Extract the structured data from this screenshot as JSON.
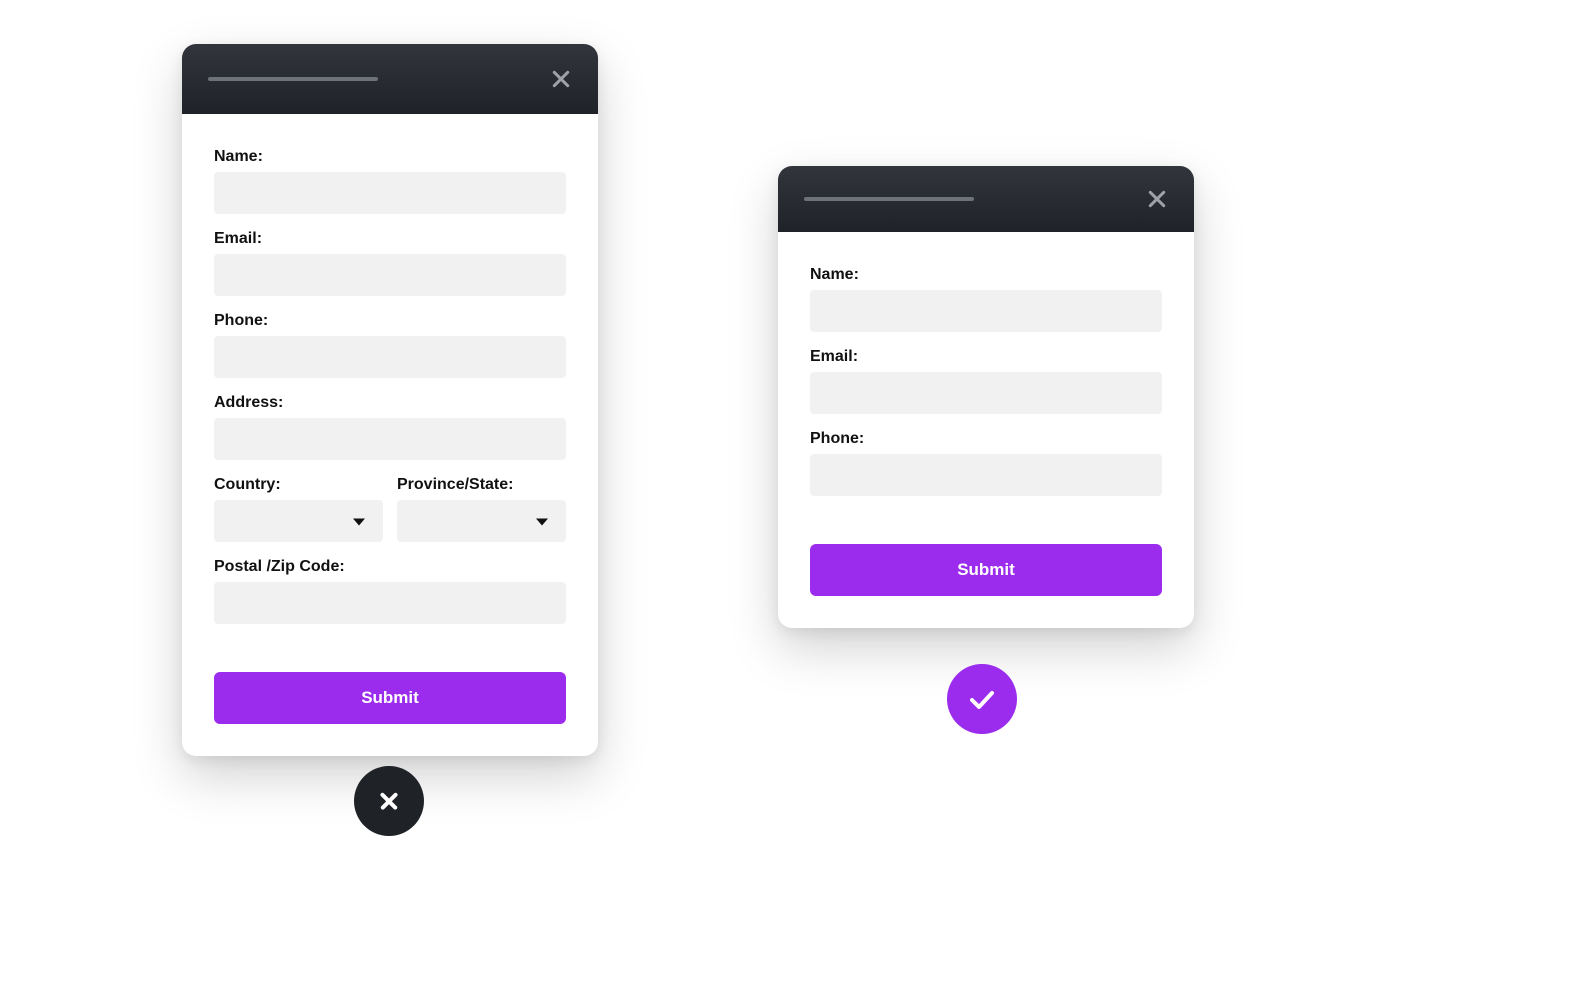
{
  "colors": {
    "accent": "#9b2bed",
    "dark": "#1f2328",
    "inputBg": "#f1f1f1"
  },
  "left_form": {
    "fields": {
      "name": {
        "label": "Name:"
      },
      "email": {
        "label": "Email:"
      },
      "phone": {
        "label": "Phone:"
      },
      "address": {
        "label": "Address:"
      },
      "country": {
        "label": "Country:"
      },
      "province": {
        "label": "Province/State:"
      },
      "postal": {
        "label": "Postal /Zip Code:"
      }
    },
    "submit_label": "Submit"
  },
  "right_form": {
    "fields": {
      "name": {
        "label": "Name:"
      },
      "email": {
        "label": "Email:"
      },
      "phone": {
        "label": "Phone:"
      }
    },
    "submit_label": "Submit"
  },
  "badges": {
    "bad": {
      "icon": "close-icon"
    },
    "good": {
      "icon": "check-icon"
    }
  }
}
